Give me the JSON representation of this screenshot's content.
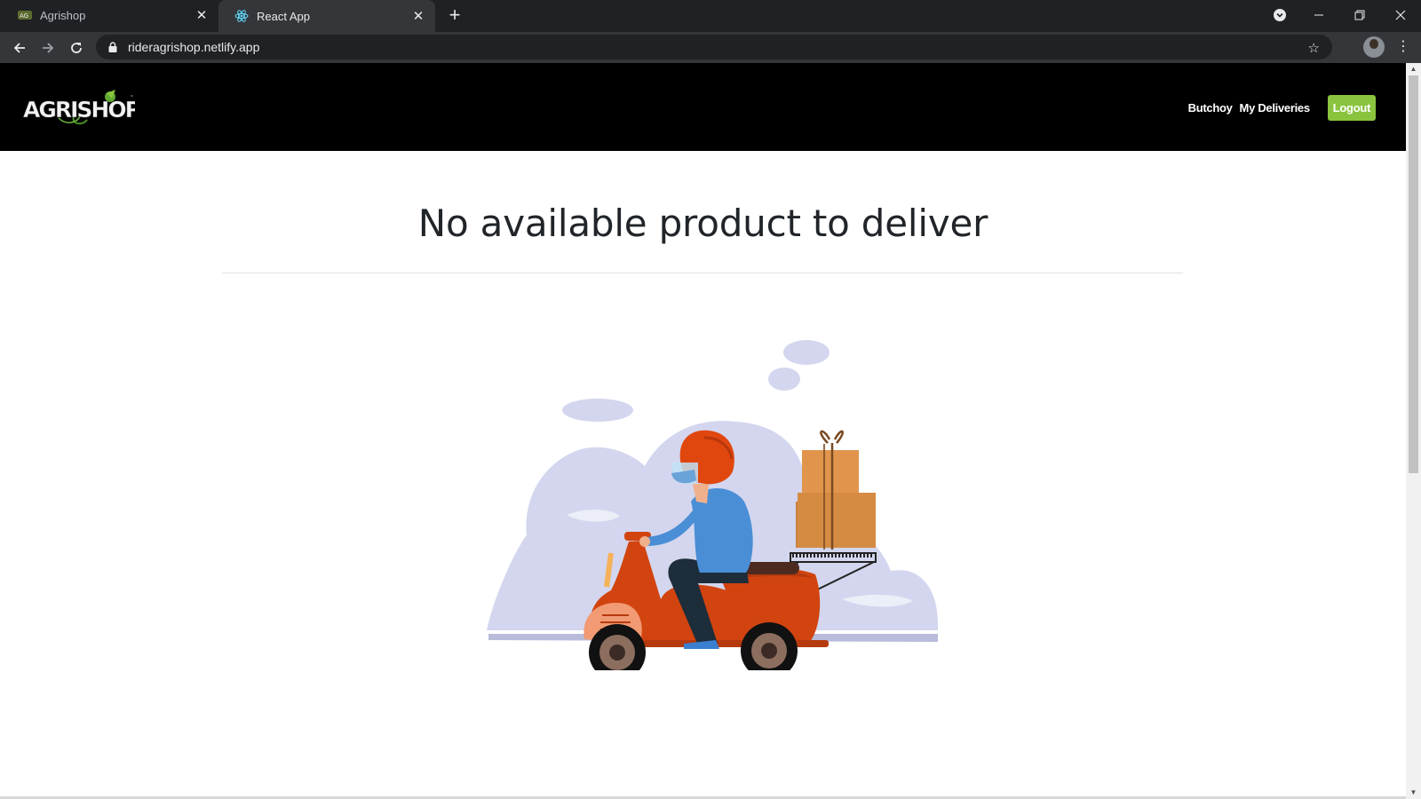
{
  "browser": {
    "tabs": [
      {
        "title": "Agrishop",
        "active": false
      },
      {
        "title": "React App",
        "active": true
      }
    ],
    "url": "rideragrishop.netlify.app"
  },
  "navbar": {
    "logo_text": "AGRISHOP",
    "user_label": "Butchoy",
    "deliveries_label": "My Deliveries",
    "logout_label": "Logout",
    "accent_color": "#8ac43f"
  },
  "main": {
    "heading": "No available product to deliver"
  }
}
